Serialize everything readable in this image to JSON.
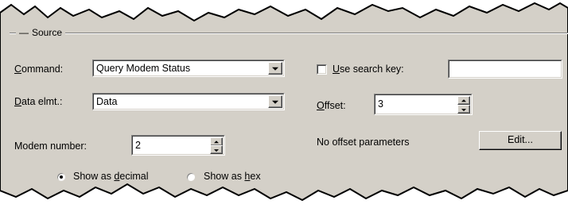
{
  "source": {
    "group_label": "Source",
    "command_label_underline": "C",
    "command_label_rest": "ommand:",
    "command_value": "Query Modem Status",
    "data_elmt_label_underline": "D",
    "data_elmt_label_rest": "ata elmt.:",
    "data_elmt_value": "Data",
    "modem_number_label": "Modem number:",
    "modem_number_value": "2",
    "radio_decimal_prefix": "Show as ",
    "radio_decimal_underline": "d",
    "radio_decimal_rest": "ecimal",
    "radio_decimal_selected": true,
    "radio_hex_prefix": "Show as ",
    "radio_hex_underline": "h",
    "radio_hex_rest": "ex",
    "radio_hex_selected": false,
    "use_search_key_underline": "U",
    "use_search_key_rest": "se search key:",
    "use_search_key_checked": false,
    "search_key_value": "",
    "offset_label_underline": "O",
    "offset_label_rest": "ffset:",
    "offset_value": "3",
    "offset_params_text": "No offset parameters",
    "edit_button_label": "Edit..."
  },
  "colors": {
    "dialog_bg": "#d4d0c8",
    "field_bg": "#ffffff"
  }
}
